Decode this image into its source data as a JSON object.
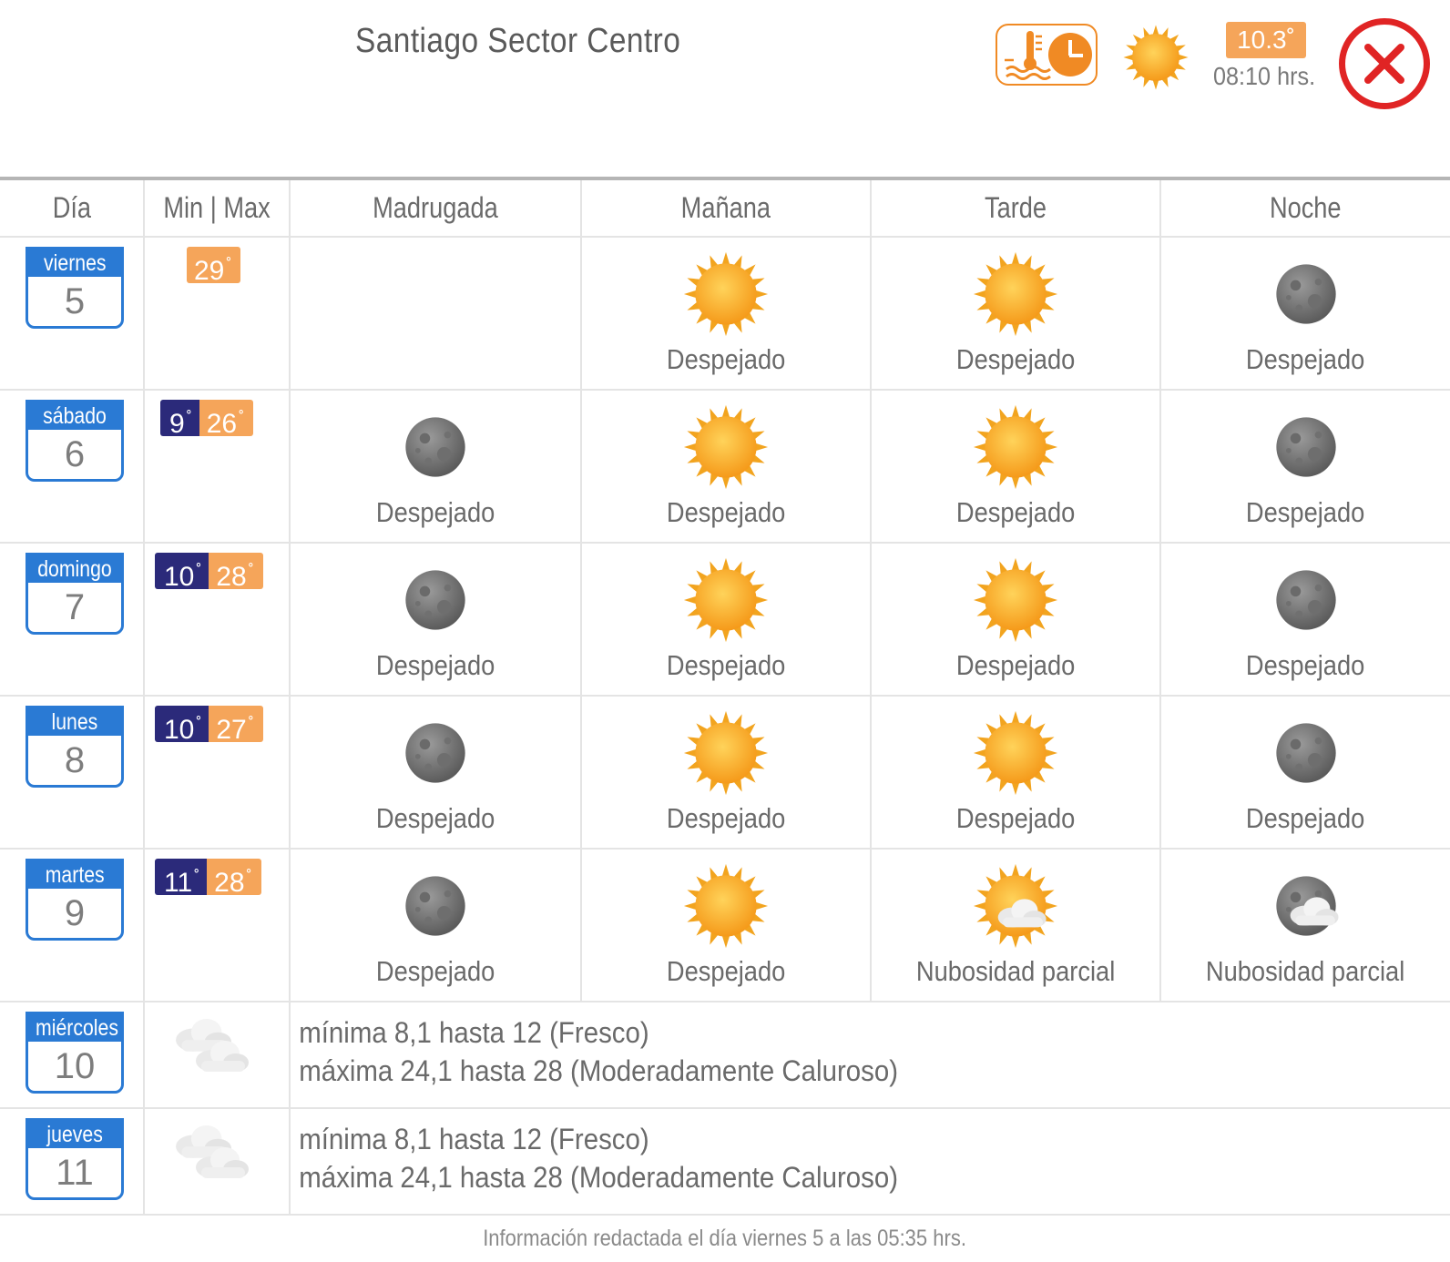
{
  "header": {
    "title": "Santiago Sector Centro",
    "current_temp": "10.3˚",
    "current_time": "08:10 hrs.",
    "current_icon": "sun-icon"
  },
  "columns": [
    "Día",
    "Min | Max",
    "Madrugada",
    "Mañana",
    "Tarde",
    "Noche"
  ],
  "days": [
    {
      "name": "viernes",
      "num": "5",
      "min": "",
      "max": "29",
      "slots": [
        null,
        {
          "icon": "sun",
          "text": "Despejado"
        },
        {
          "icon": "sun",
          "text": "Despejado"
        },
        {
          "icon": "moon",
          "text": "Despejado"
        }
      ]
    },
    {
      "name": "sábado",
      "num": "6",
      "min": "9",
      "max": "26",
      "slots": [
        {
          "icon": "moon",
          "text": "Despejado"
        },
        {
          "icon": "sun",
          "text": "Despejado"
        },
        {
          "icon": "sun",
          "text": "Despejado"
        },
        {
          "icon": "moon",
          "text": "Despejado"
        }
      ]
    },
    {
      "name": "domingo",
      "num": "7",
      "min": "10",
      "max": "28",
      "slots": [
        {
          "icon": "moon",
          "text": "Despejado"
        },
        {
          "icon": "sun",
          "text": "Despejado"
        },
        {
          "icon": "sun",
          "text": "Despejado"
        },
        {
          "icon": "moon",
          "text": "Despejado"
        }
      ]
    },
    {
      "name": "lunes",
      "num": "8",
      "min": "10",
      "max": "27",
      "slots": [
        {
          "icon": "moon",
          "text": "Despejado"
        },
        {
          "icon": "sun",
          "text": "Despejado"
        },
        {
          "icon": "sun",
          "text": "Despejado"
        },
        {
          "icon": "moon",
          "text": "Despejado"
        }
      ]
    },
    {
      "name": "martes",
      "num": "9",
      "min": "11",
      "max": "28",
      "slots": [
        {
          "icon": "moon",
          "text": "Despejado"
        },
        {
          "icon": "sun",
          "text": "Despejado"
        },
        {
          "icon": "sun-cloud",
          "text": "Nubosidad parcial"
        },
        {
          "icon": "moon-cloud",
          "text": "Nubosidad parcial"
        }
      ]
    }
  ],
  "extended": [
    {
      "name": "miércoles",
      "num": "10",
      "icon": "clouds",
      "min_line": "mínima 8,1 hasta 12 (Fresco)",
      "max_line": "máxima 24,1 hasta 28 (Moderadamente Caluroso)"
    },
    {
      "name": "jueves",
      "num": "11",
      "icon": "clouds",
      "min_line": "mínima 8,1 hasta 12 (Fresco)",
      "max_line": "máxima 24,1 hasta 28 (Moderadamente Caluroso)"
    }
  ],
  "footer": "Información redactada el día viernes 5 a las 05:35 hrs.",
  "colors": {
    "accent_blue": "#2a7ad4",
    "min_bg": "#2b2a7a",
    "max_bg": "#f5a55a",
    "close_red": "#e02424",
    "orange": "#f08a24"
  }
}
